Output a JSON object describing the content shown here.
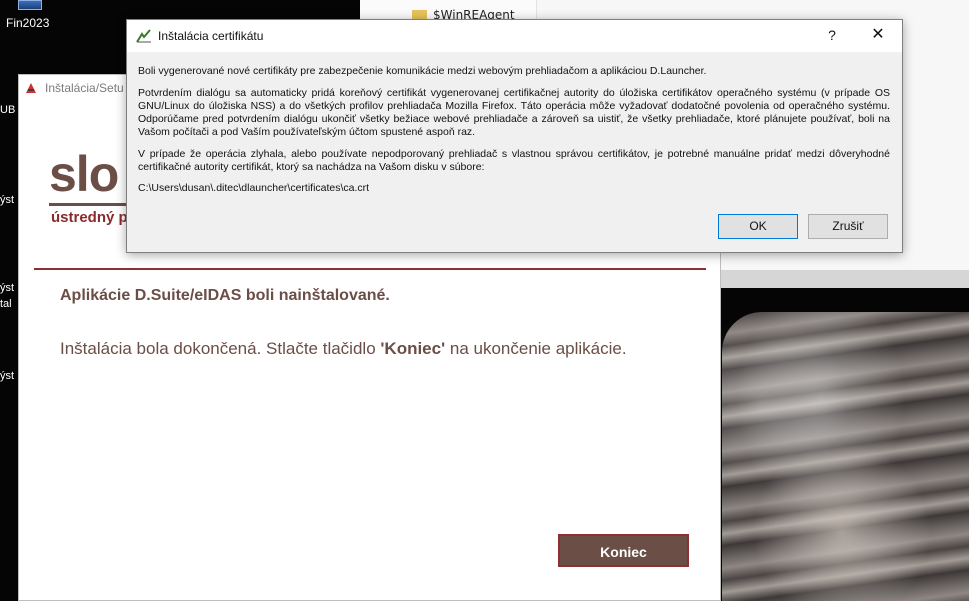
{
  "desktop": {
    "icons": [
      {
        "label": "Fin2023"
      },
      {
        "label": "UB"
      },
      {
        "label": "ýst"
      },
      {
        "label": "ýst"
      },
      {
        "label": "tal"
      },
      {
        "label": "ýst"
      }
    ]
  },
  "explorer": {
    "folder_item": "$WinREAgent"
  },
  "installer": {
    "window_title": "Inštalácia/Setu",
    "logo_text": "slo",
    "tagline": "ústredný p",
    "heading": "Aplikácie D.Suite/eIDAS boli nainštalované.",
    "body_prefix": "Inštalácia bola dokončená. Stlačte tlačidlo ",
    "body_bold": "'Koniec'",
    "body_suffix": " na ukončenie aplikácie.",
    "finish_button": "Koniec"
  },
  "dialog": {
    "title": "Inštalácia certifikátu",
    "help_glyph": "?",
    "close_glyph": "✕",
    "paragraphs": [
      "Boli vygenerované nové certifikáty pre zabezpečenie komunikácie medzi webovým prehliadačom a aplikáciou D.Launcher.",
      "Potvrdením dialógu sa automaticky pridá koreňový certifikát vygenerovanej certifikačnej autority do úložiska certifikátov operačného systému (v prípade OS GNU/Linux do úložiska NSS) a do všetkých profilov prehliadača Mozilla Firefox. Táto operácia môže vyžadovať dodatočné povolenia od operačného systému. Odporúčame pred potvrdením dialógu ukončiť všetky bežiace webové prehliadače a zároveň sa uistiť, že všetky prehliadače, ktoré plánujete používať, boli na Vašom počítači a pod Vaším používateľským účtom spustené aspoň raz.",
      "V prípade že operácia zlyhala, alebo používate nepodporovaný prehliadač s vlastnou správou certifikátov, je potrebné manuálne pridať medzi dôveryhodné certifikačné autority certifikát, ktorý sa nachádza na Vašom disku v súbore:"
    ],
    "path": "C:\\Users\\dusan\\.ditec\\dlauncher\\certificates\\ca.crt",
    "ok_button": "OK",
    "cancel_button": "Zrušiť"
  }
}
